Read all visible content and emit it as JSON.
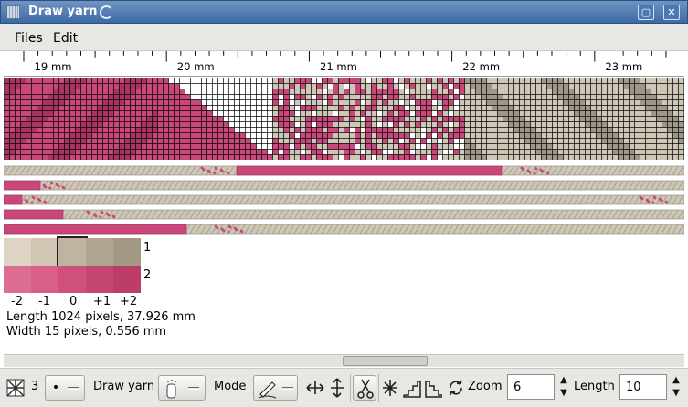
{
  "window": {
    "title": "Draw yarn"
  },
  "menu": {
    "items": [
      "Files",
      "Edit"
    ]
  },
  "ruler": {
    "labels": [
      "19 mm",
      "20 mm",
      "21 mm",
      "22 mm",
      "23 mm"
    ]
  },
  "palette": {
    "row1_label": "1",
    "row2_label": "2",
    "row1_colors": [
      "#ddd4c4",
      "#d0c6b4",
      "#bfb3a2",
      "#b0a593",
      "#a29884"
    ],
    "row2_colors": [
      "#dd6e91",
      "#d85f86",
      "#cf507c",
      "#c64673",
      "#bc3d68"
    ],
    "selected_index": 2,
    "offsets": [
      "-2",
      "-1",
      "0",
      "+1",
      "+2"
    ]
  },
  "info": {
    "length": "Length 1024 pixels, 37.926 mm",
    "width": "Width 15 pixels, 0.556 mm"
  },
  "toolbar": {
    "count_value": "3",
    "draw_yarn_label": "Draw yarn",
    "mode_label": "Mode",
    "zoom_label": "Zoom",
    "zoom_value": "6",
    "length_label": "Length",
    "length_value": "10"
  },
  "colors": {
    "pink": "#c9477a",
    "dark_pink": "#a83461",
    "beige": "#cfc7b6",
    "gray": "#9f968a",
    "white": "#ffffff"
  },
  "icons": [
    "pattern-icon",
    "dot-selector-icon",
    "yarn-brush-icon",
    "pen-icon",
    "flip-horizontal-icon",
    "flip-vertical-icon",
    "scissors-icon",
    "sparkle-icon",
    "stairs-up-icon",
    "stairs-down-icon",
    "rotate-icon"
  ]
}
